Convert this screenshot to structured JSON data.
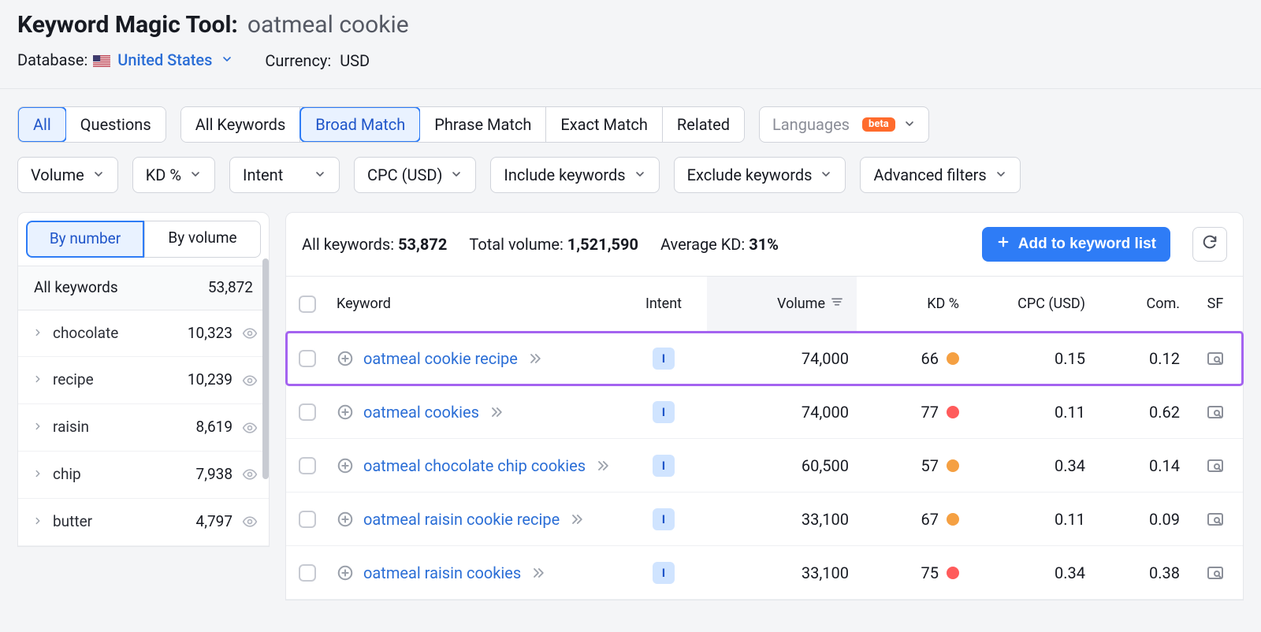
{
  "header": {
    "title_label": "Keyword Magic Tool:",
    "query": "oatmeal cookie",
    "db_label": "Database:",
    "db_value": "United States",
    "currency_label": "Currency:",
    "currency_value": "USD"
  },
  "toolbar": {
    "scope": {
      "all": "All",
      "questions": "Questions"
    },
    "match": {
      "all": "All Keywords",
      "broad": "Broad Match",
      "phrase": "Phrase Match",
      "exact": "Exact Match",
      "related": "Related"
    },
    "lang_label": "Languages",
    "beta_label": "beta"
  },
  "filters": {
    "volume": "Volume",
    "kd": "KD %",
    "intent": "Intent",
    "cpc": "CPC (USD)",
    "include": "Include keywords",
    "exclude": "Exclude keywords",
    "advanced": "Advanced filters"
  },
  "left": {
    "tabs": {
      "number": "By number",
      "volume": "By volume"
    },
    "head_label": "All keywords",
    "head_count": "53,872",
    "groups": [
      {
        "term": "chocolate",
        "count": "10,323"
      },
      {
        "term": "recipe",
        "count": "10,239"
      },
      {
        "term": "raisin",
        "count": "8,619"
      },
      {
        "term": "chip",
        "count": "7,938"
      },
      {
        "term": "butter",
        "count": "4,797"
      }
    ]
  },
  "summary": {
    "all_label": "All keywords:",
    "all_value": "53,872",
    "vol_label": "Total volume:",
    "vol_value": "1,521,590",
    "kd_label": "Average KD:",
    "kd_value": "31%",
    "add_btn": "Add to keyword list"
  },
  "columns": {
    "keyword": "Keyword",
    "intent": "Intent",
    "volume": "Volume",
    "kd": "KD %",
    "cpc": "CPC (USD)",
    "com": "Com.",
    "sf": "SF"
  },
  "rows": [
    {
      "kw": "oatmeal cookie recipe",
      "intent": "I",
      "volume": "74,000",
      "kd": "66",
      "kd_col": "orange",
      "cpc": "0.15",
      "com": "0.12",
      "highlight": true
    },
    {
      "kw": "oatmeal cookies",
      "intent": "I",
      "volume": "74,000",
      "kd": "77",
      "kd_col": "red",
      "cpc": "0.11",
      "com": "0.62",
      "highlight": false
    },
    {
      "kw": "oatmeal chocolate chip cookies",
      "intent": "I",
      "volume": "60,500",
      "kd": "57",
      "kd_col": "orange",
      "cpc": "0.34",
      "com": "0.14",
      "highlight": false
    },
    {
      "kw": "oatmeal raisin cookie recipe",
      "intent": "I",
      "volume": "33,100",
      "kd": "67",
      "kd_col": "orange",
      "cpc": "0.11",
      "com": "0.09",
      "highlight": false
    },
    {
      "kw": "oatmeal raisin cookies",
      "intent": "I",
      "volume": "33,100",
      "kd": "75",
      "kd_col": "red",
      "cpc": "0.34",
      "com": "0.38",
      "highlight": false
    }
  ]
}
